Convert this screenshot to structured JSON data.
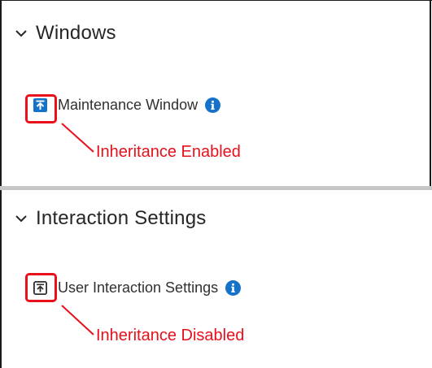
{
  "sections": [
    {
      "title": "Windows",
      "setting": {
        "label": "Maintenance Window",
        "inheritance_icon": "arrow-up-square-icon",
        "inheritance_state": "enabled",
        "info_icon": "info-circle-icon"
      },
      "callout": "Inheritance Enabled"
    },
    {
      "title": "Interaction Settings",
      "setting": {
        "label": "User Interaction Settings",
        "inheritance_icon": "arrow-up-square-icon",
        "inheritance_state": "disabled",
        "info_icon": "info-circle-icon"
      },
      "callout": "Inheritance Disabled"
    }
  ],
  "colors": {
    "accent_blue": "#1473c9",
    "annotation_red": "#e8101a",
    "disabled_icon": "#2e2e2e",
    "divider": "#c7c7c7"
  }
}
